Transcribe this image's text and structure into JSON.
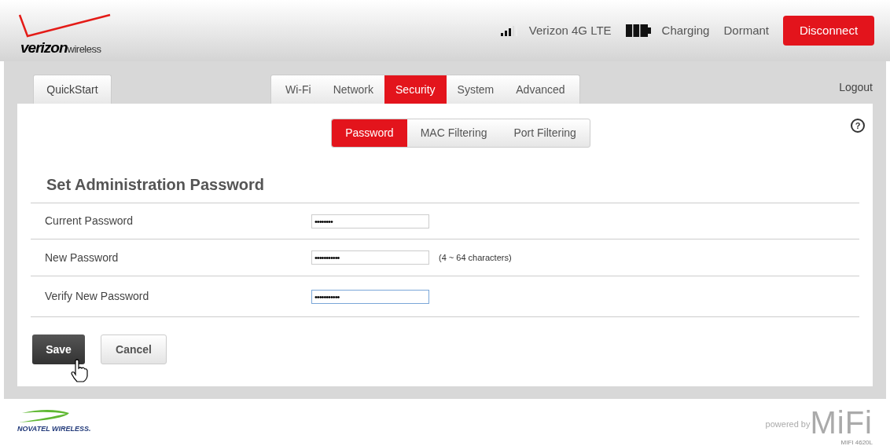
{
  "header": {
    "logo": {
      "brand": "verizon",
      "suffix": "wireless"
    },
    "carrier": "Verizon 4G LTE",
    "battery": "Charging",
    "connection": "Dormant",
    "disconnect_button": "Disconnect"
  },
  "quickstart_tab": "QuickStart",
  "tabs": [
    {
      "label": "Wi-Fi",
      "selected": false
    },
    {
      "label": "Network",
      "selected": false
    },
    {
      "label": "Security",
      "selected": true
    },
    {
      "label": "System",
      "selected": false
    },
    {
      "label": "Advanced",
      "selected": false
    }
  ],
  "logout": "Logout",
  "subtabs": [
    {
      "label": "Password",
      "selected": true
    },
    {
      "label": "MAC Filtering",
      "selected": false
    },
    {
      "label": "Port Filtering",
      "selected": false
    }
  ],
  "help_icon": "?",
  "section_title": "Set Administration Password",
  "fields": [
    {
      "label": "Current Password",
      "value": "••••••••",
      "focused": false
    },
    {
      "label": "New Password",
      "value": "•••••••••••",
      "hint": "(4 ~ 64 characters)",
      "focused": false
    },
    {
      "label": "Verify New Password",
      "value": "•••••••••••",
      "focused": true
    }
  ],
  "buttons": [
    {
      "label": "Save",
      "kind": "primary"
    },
    {
      "label": "Cancel",
      "kind": "secondary"
    }
  ],
  "footer": {
    "maker": "NOVATEL WIRELESS.",
    "powered_by": "powered by",
    "product": "MiFi",
    "model": "MIFI 4620L"
  }
}
